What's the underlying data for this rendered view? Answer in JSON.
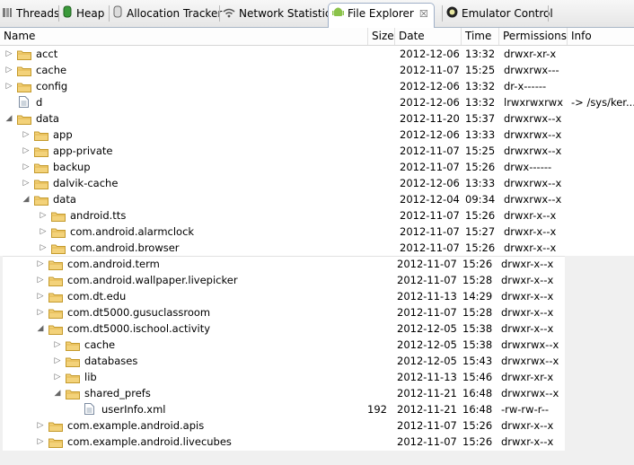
{
  "tabs": [
    {
      "label": "Threads",
      "icon": "threads-icon"
    },
    {
      "label": "Heap",
      "icon": "heap-icon"
    },
    {
      "label": "Allocation Tracker",
      "icon": "allocation-icon"
    },
    {
      "label": "Network Statistics",
      "icon": "wifi-icon"
    },
    {
      "label": "File Explorer",
      "icon": "android-icon",
      "active": true,
      "close": "☒"
    },
    {
      "label": "Emulator Control",
      "icon": "emulator-icon"
    }
  ],
  "columns": {
    "name": "Name",
    "size": "Size",
    "date": "Date",
    "time": "Time",
    "permissions": "Permissions",
    "info": "Info"
  },
  "rows": [
    {
      "name": "acct",
      "type": "folder",
      "depth": 0,
      "expanded": false,
      "size": "",
      "date": "2012-12-06",
      "time": "13:32",
      "perm": "drwxr-xr-x",
      "info": ""
    },
    {
      "name": "cache",
      "type": "folder",
      "depth": 0,
      "expanded": false,
      "size": "",
      "date": "2012-11-07",
      "time": "15:25",
      "perm": "drwxrwx---",
      "info": ""
    },
    {
      "name": "config",
      "type": "folder",
      "depth": 0,
      "expanded": false,
      "size": "",
      "date": "2012-12-06",
      "time": "13:32",
      "perm": "dr-x------",
      "info": ""
    },
    {
      "name": "d",
      "type": "file",
      "depth": 0,
      "expanded": false,
      "size": "",
      "date": "2012-12-06",
      "time": "13:32",
      "perm": "lrwxrwxrwx",
      "info": "-> /sys/ker..."
    },
    {
      "name": "data",
      "type": "folder",
      "depth": 0,
      "expanded": true,
      "size": "",
      "date": "2012-11-20",
      "time": "15:37",
      "perm": "drwxrwx--x",
      "info": ""
    },
    {
      "name": "app",
      "type": "folder",
      "depth": 1,
      "expanded": false,
      "size": "",
      "date": "2012-12-06",
      "time": "13:33",
      "perm": "drwxrwx--x",
      "info": ""
    },
    {
      "name": "app-private",
      "type": "folder",
      "depth": 1,
      "expanded": false,
      "size": "",
      "date": "2012-11-07",
      "time": "15:25",
      "perm": "drwxrwx--x",
      "info": ""
    },
    {
      "name": "backup",
      "type": "folder",
      "depth": 1,
      "expanded": false,
      "size": "",
      "date": "2012-11-07",
      "time": "15:26",
      "perm": "drwx------",
      "info": ""
    },
    {
      "name": "dalvik-cache",
      "type": "folder",
      "depth": 1,
      "expanded": false,
      "size": "",
      "date": "2012-12-06",
      "time": "13:33",
      "perm": "drwxrwx--x",
      "info": ""
    },
    {
      "name": "data",
      "type": "folder",
      "depth": 1,
      "expanded": true,
      "size": "",
      "date": "2012-12-04",
      "time": "09:34",
      "perm": "drwxrwx--x",
      "info": ""
    },
    {
      "name": "android.tts",
      "type": "folder",
      "depth": 2,
      "expanded": false,
      "size": "",
      "date": "2012-11-07",
      "time": "15:26",
      "perm": "drwxr-x--x",
      "info": ""
    },
    {
      "name": "com.android.alarmclock",
      "type": "folder",
      "depth": 2,
      "expanded": false,
      "size": "",
      "date": "2012-11-07",
      "time": "15:27",
      "perm": "drwxr-x--x",
      "info": ""
    },
    {
      "name": "com.android.browser",
      "type": "folder",
      "depth": 2,
      "expanded": false,
      "size": "",
      "date": "2012-11-07",
      "time": "15:26",
      "perm": "drwxr-x--x",
      "info": ""
    },
    {
      "name": "com.android.term",
      "type": "folder",
      "depth": 2,
      "expanded": false,
      "size": "",
      "date": "2012-11-07",
      "time": "15:26",
      "perm": "drwxr-x--x",
      "info": ""
    },
    {
      "name": "com.android.wallpaper.livepicker",
      "type": "folder",
      "depth": 2,
      "expanded": false,
      "size": "",
      "date": "2012-11-07",
      "time": "15:28",
      "perm": "drwxr-x--x",
      "info": ""
    },
    {
      "name": "com.dt.edu",
      "type": "folder",
      "depth": 2,
      "expanded": false,
      "size": "",
      "date": "2012-11-13",
      "time": "14:29",
      "perm": "drwxr-x--x",
      "info": ""
    },
    {
      "name": "com.dt5000.gusuclassroom",
      "type": "folder",
      "depth": 2,
      "expanded": false,
      "size": "",
      "date": "2012-11-07",
      "time": "15:28",
      "perm": "drwxr-x--x",
      "info": ""
    },
    {
      "name": "com.dt5000.ischool.activity",
      "type": "folder",
      "depth": 2,
      "expanded": true,
      "size": "",
      "date": "2012-12-05",
      "time": "15:38",
      "perm": "drwxr-x--x",
      "info": ""
    },
    {
      "name": "cache",
      "type": "folder",
      "depth": 3,
      "expanded": false,
      "size": "",
      "date": "2012-12-05",
      "time": "15:38",
      "perm": "drwxrwx--x",
      "info": ""
    },
    {
      "name": "databases",
      "type": "folder",
      "depth": 3,
      "expanded": false,
      "size": "",
      "date": "2012-12-05",
      "time": "15:43",
      "perm": "drwxrwx--x",
      "info": ""
    },
    {
      "name": "lib",
      "type": "folder",
      "depth": 3,
      "expanded": false,
      "size": "",
      "date": "2012-11-13",
      "time": "15:46",
      "perm": "drwxr-xr-x",
      "info": ""
    },
    {
      "name": "shared_prefs",
      "type": "folder",
      "depth": 3,
      "expanded": true,
      "size": "",
      "date": "2012-11-21",
      "time": "16:48",
      "perm": "drwxrwx--x",
      "info": ""
    },
    {
      "name": "userInfo.xml",
      "type": "file",
      "depth": 4,
      "expanded": false,
      "size": "192",
      "date": "2012-11-21",
      "time": "16:48",
      "perm": "-rw-rw-r--",
      "info": ""
    },
    {
      "name": "com.example.android.apis",
      "type": "folder",
      "depth": 2,
      "expanded": false,
      "size": "",
      "date": "2012-11-07",
      "time": "15:26",
      "perm": "drwxr-x--x",
      "info": ""
    },
    {
      "name": "com.example.android.livecubes",
      "type": "folder",
      "depth": 2,
      "expanded": false,
      "size": "",
      "date": "2012-11-07",
      "time": "15:26",
      "perm": "drwxr-x--x",
      "info": ""
    }
  ]
}
